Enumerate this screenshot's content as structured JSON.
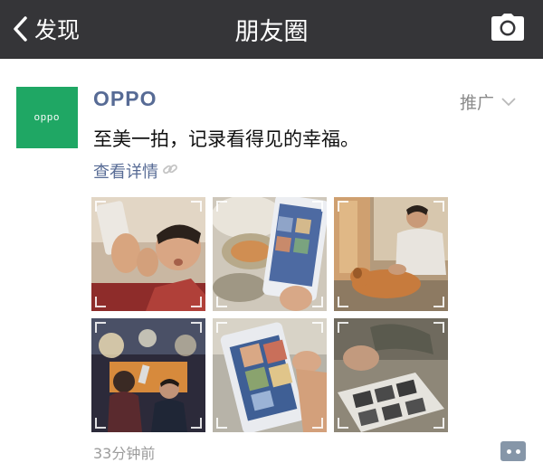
{
  "navbar": {
    "back_label": "发现",
    "title": "朋友圈",
    "back_icon": "chevron-left-icon",
    "camera_icon": "camera-icon"
  },
  "post": {
    "author": "OPPO",
    "avatar_text": "oppo",
    "avatar_color": "#1fa764",
    "ad_label": "推广",
    "text": "至美一拍，记录看得见的幸福。",
    "details_label": "查看详情",
    "link_icon": "link-icon",
    "timestamp": "33分钟前",
    "comment_icon": "comment-dots-icon",
    "photos": [
      {
        "subject": "young man holding phone selfie"
      },
      {
        "subject": "phone showing photo gallery on table"
      },
      {
        "subject": "man petting dog on floor"
      },
      {
        "subject": "friends at night event"
      },
      {
        "subject": "hand holding phone with gallery"
      },
      {
        "subject": "old photo album being viewed"
      }
    ]
  },
  "colors": {
    "navbar_bg": "#353538",
    "link_blue": "#576b95",
    "brand_green": "#1fa764"
  }
}
